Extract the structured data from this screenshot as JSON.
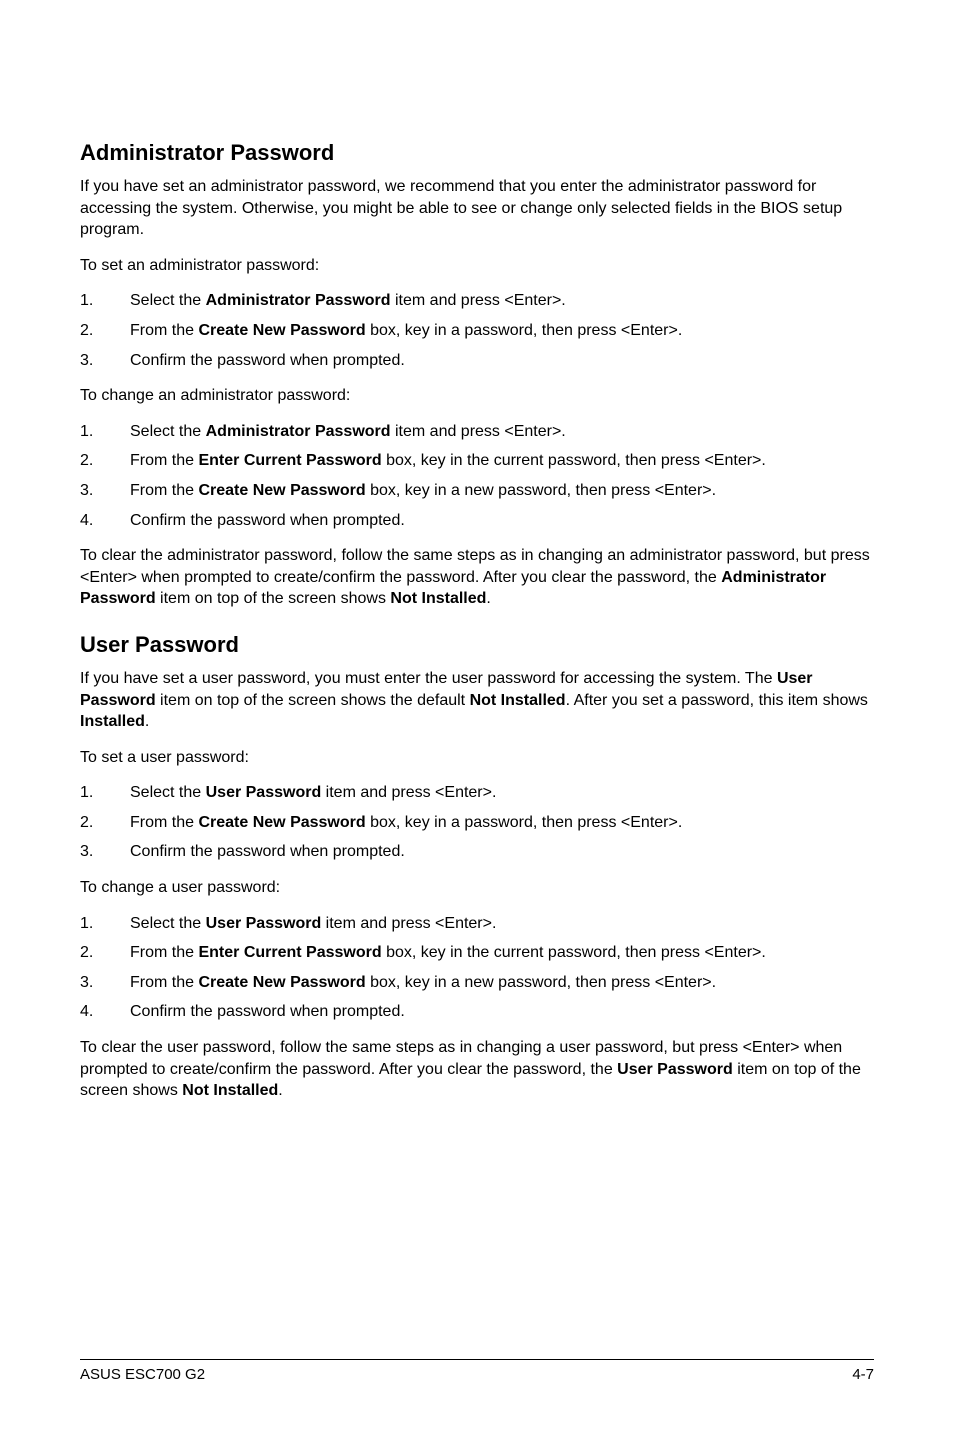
{
  "section1": {
    "heading": "Administrator Password",
    "intro": "If you have set an administrator password, we recommend that you enter the administrator password for accessing the system. Otherwise, you might be able to see or change only selected fields in the BIOS setup program.",
    "set_intro": "To set an administrator password:",
    "set_list": {
      "item1_num": "1.",
      "item1_a": "Select the ",
      "item1_b": "Administrator Password",
      "item1_c": " item and press <Enter>.",
      "item2_num": "2.",
      "item2_a": "From the ",
      "item2_b": "Create New Password",
      "item2_c": " box, key in a password, then press <Enter>.",
      "item3_num": "3.",
      "item3": "Confirm the password when prompted."
    },
    "change_intro": "To change an administrator password:",
    "change_list": {
      "item1_num": "1.",
      "item1_a": "Select the ",
      "item1_b": "Administrator Password",
      "item1_c": " item and press <Enter>.",
      "item2_num": "2.",
      "item2_a": "From the ",
      "item2_b": "Enter Current Password",
      "item2_c": " box, key in the current password, then press <Enter>.",
      "item3_num": "3.",
      "item3_a": "From the ",
      "item3_b": "Create New Password",
      "item3_c": " box, key in a new password, then press <Enter>.",
      "item4_num": "4.",
      "item4": "Confirm the password when prompted."
    },
    "clear_a": "To clear the administrator password, follow the same steps as in changing an administrator password, but press <Enter> when prompted to create/confirm the password. After you clear the password, the ",
    "clear_b": "Administrator Password",
    "clear_c": " item on top of the screen shows ",
    "clear_d": "Not Installed",
    "clear_e": "."
  },
  "section2": {
    "heading": "User Password",
    "intro_a": "If you have set a user password, you must enter the user password for accessing the system. The ",
    "intro_b": "User Password",
    "intro_c": " item on top of the screen shows the default ",
    "intro_d": "Not Installed",
    "intro_e": ". After you set a password, this item shows ",
    "intro_f": "Installed",
    "intro_g": ".",
    "set_intro": "To set a user password:",
    "set_list": {
      "item1_num": "1.",
      "item1_a": "Select the ",
      "item1_b": "User Password",
      "item1_c": " item and press <Enter>.",
      "item2_num": "2.",
      "item2_a": "From the ",
      "item2_b": "Create New Password",
      "item2_c": " box, key in a password, then press <Enter>.",
      "item3_num": "3.",
      "item3": "Confirm the password when prompted."
    },
    "change_intro": "To change a user password:",
    "change_list": {
      "item1_num": "1.",
      "item1_a": "Select the ",
      "item1_b": "User Password",
      "item1_c": " item and press <Enter>.",
      "item2_num": "2.",
      "item2_a": "From the ",
      "item2_b": "Enter Current Password",
      "item2_c": " box, key in the current password, then press <Enter>.",
      "item3_num": "3.",
      "item3_a": "From the ",
      "item3_b": "Create New Password",
      "item3_c": " box, key in a new password, then press <Enter>.",
      "item4_num": "4.",
      "item4": "Confirm the password when prompted."
    },
    "clear_a": "To clear the user password, follow the same steps as in changing a user password, but press <Enter> when prompted to create/confirm the password. After you clear the password, the ",
    "clear_b": "User Password",
    "clear_c": " item on top of the screen shows ",
    "clear_d": "Not Installed",
    "clear_e": "."
  },
  "footer": {
    "left": "ASUS ESC700 G2",
    "right": "4-7"
  }
}
